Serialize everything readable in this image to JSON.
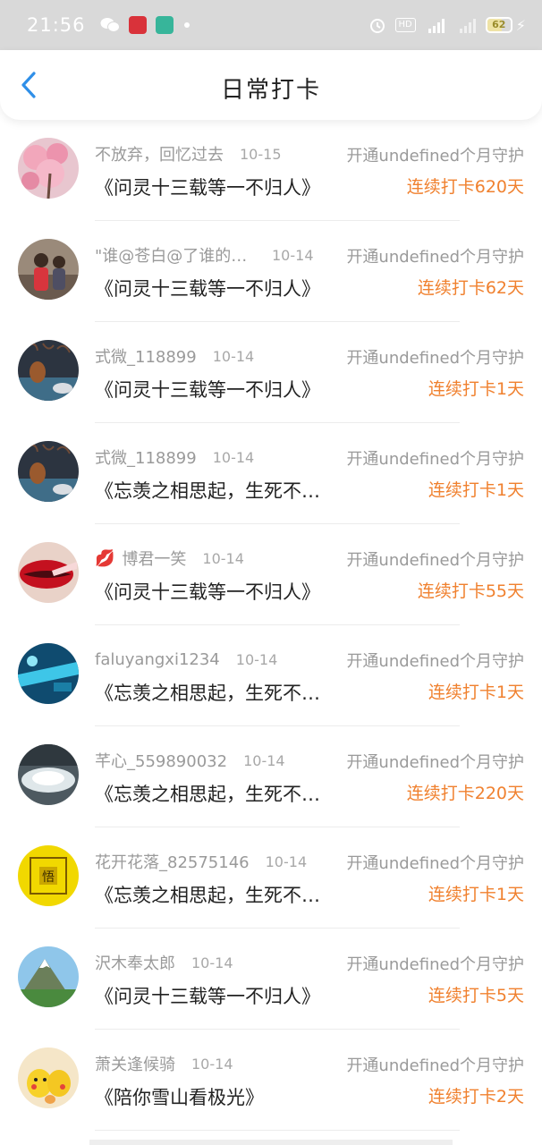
{
  "status_bar": {
    "time": "21:56",
    "hd_label": "HD",
    "battery_level": "62",
    "icons": [
      "wechat-icon",
      "app-icon-red",
      "app-icon-green",
      "notification-dot",
      "alarm-icon",
      "hd-icon",
      "signal-4g-icon",
      "signal-icon-2",
      "battery-icon",
      "charging-icon"
    ]
  },
  "header": {
    "title": "日常打卡",
    "back_icon": "chevron-left-icon"
  },
  "colors": {
    "accent_blue": "#2f8fe8",
    "streak_orange": "#f0812f",
    "status_bar_bg": "#d9d9d9"
  },
  "items": [
    {
      "username": "不放弃，回忆过去",
      "date": "10-15",
      "guard": "开通undefined个月守护",
      "book": "《问灵十三载等一不归人》",
      "streak": "连续打卡620天",
      "avatar": "pink-blossom"
    },
    {
      "username": "\"谁@苍白@了谁的年华",
      "date": "10-14",
      "guard": "开通undefined个月守护",
      "book": "《问灵十三载等一不归人》",
      "streak": "连续打卡62天",
      "avatar": "kids"
    },
    {
      "username": "式微_118899",
      "date": "10-14",
      "guard": "开通undefined个月守护",
      "book": "《问灵十三载等一不归人》",
      "streak": "连续打卡1天",
      "avatar": "vase"
    },
    {
      "username": "式微_118899",
      "date": "10-14",
      "guard": "开通undefined个月守护",
      "book": "《忘羡之相思起，生死不离》",
      "streak": "连续打卡1天",
      "avatar": "vase"
    },
    {
      "username": "博君一笑",
      "date": "10-14",
      "guard": "开通undefined个月守护",
      "book": "《问灵十三载等一不归人》",
      "streak": "连续打卡55天",
      "avatar": "lips",
      "badge": "lips-icon"
    },
    {
      "username": "faluyangxi1234",
      "date": "10-14",
      "guard": "开通undefined个月守护",
      "book": "《忘羡之相思起，生死不离》",
      "streak": "连续打卡1天",
      "avatar": "blue"
    },
    {
      "username": "芊心_559890032",
      "date": "10-14",
      "guard": "开通undefined个月守护",
      "book": "《忘羡之相思起，生死不离》",
      "streak": "连续打卡220天",
      "avatar": "waterfall"
    },
    {
      "username": "花开花落_82575146",
      "date": "10-14",
      "guard": "开通undefined个月守护",
      "book": "《忘羡之相思起，生死不离》",
      "streak": "连续打卡1天",
      "avatar": "bagua"
    },
    {
      "username": "沢木奉太郎",
      "date": "10-14",
      "guard": "开通undefined个月守护",
      "book": "《问灵十三载等一不归人》",
      "streak": "连续打卡5天",
      "avatar": "mountain"
    },
    {
      "username": "萧关逢候骑",
      "date": "10-14",
      "guard": "开通undefined个月守护",
      "book": "《陪你雪山看极光》",
      "streak": "连续打卡2天",
      "avatar": "pikachu"
    }
  ]
}
